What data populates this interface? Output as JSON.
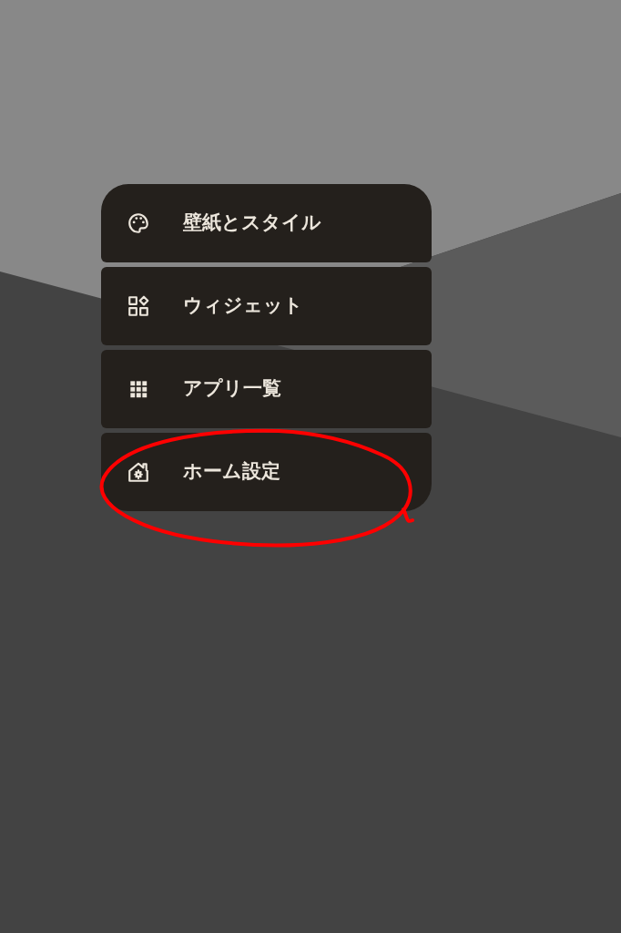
{
  "menu": {
    "items": [
      {
        "kind": "palette",
        "label": "壁紙とスタイル",
        "circled": false
      },
      {
        "kind": "widgets",
        "label": "ウィジェット",
        "circled": false
      },
      {
        "kind": "apps",
        "label": "アプリ一覧",
        "circled": false
      },
      {
        "kind": "home-settings",
        "label": "ホーム設定",
        "circled": true
      }
    ]
  }
}
